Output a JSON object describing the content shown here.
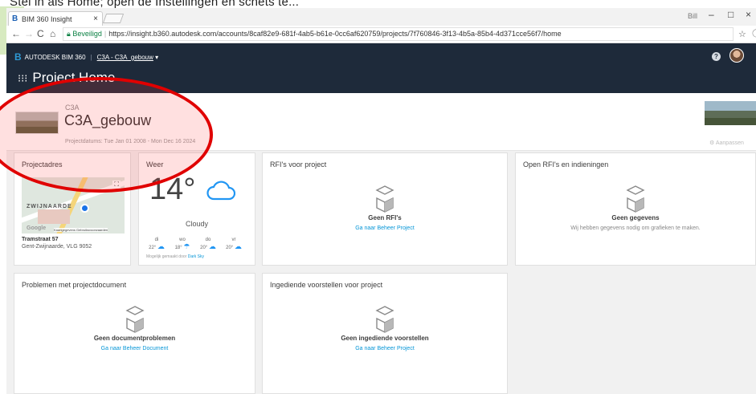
{
  "overlay_text": "Stel in als Home; open de Instellingen en schets te...",
  "browser": {
    "tab_title": "BIM 360 Insight",
    "win_user": "Bill",
    "secure_label": "Beveiligd",
    "url": "https://insight.b360.autodesk.com/accounts/8caf82e9-681f-4ab5-b61e-0cc6af620759/projects/7f760846-3f13-4b5a-85b4-4d371cce56f7/home"
  },
  "header": {
    "brand": "AUTODESK BIM 360",
    "breadcrumb": "C3A - C3A_gebouw",
    "page_title": "Project Home"
  },
  "project": {
    "subtitle": "C3A",
    "name": "C3A_gebouw",
    "dates": "Projectdatums: Tue Jan 01 2008 - Mon Dec 16 2024",
    "customize": "Aanpassen"
  },
  "cards": {
    "address": {
      "title": "Projectadres",
      "map_label": "ZWIJNAARDE",
      "map_brand": "Google",
      "map_data": "Kaartgegevens   Gebruiksvoorwaarden",
      "street": "Tramstraat 57",
      "city": "Gent-Zwijnaarde, VLG 9052"
    },
    "weather": {
      "title": "Weer",
      "temp": "14°",
      "condition": "Cloudy",
      "forecast": [
        {
          "day": "di",
          "temp": "22°"
        },
        {
          "day": "wo",
          "temp": "18°"
        },
        {
          "day": "do",
          "temp": "20°"
        },
        {
          "day": "vr",
          "temp": "20°"
        }
      ],
      "powered": "Mogelijk gemaakt door",
      "powered_by": "Dark Sky"
    },
    "rfis": {
      "title": "RFI's voor project",
      "empty": "Geen RFI's",
      "link": "Ga naar Beheer Project"
    },
    "open_rfis": {
      "title": "Open RFI's en indieningen",
      "empty": "Geen gegevens",
      "note": "Wij hebben gegevens nodig om grafieken te maken."
    },
    "doc_issues": {
      "title": "Problemen met projectdocument",
      "empty": "Geen documentproblemen",
      "link": "Ga naar Beheer Document"
    },
    "submittals": {
      "title": "Ingediende voorstellen voor project",
      "empty": "Geen ingediende voorstellen",
      "link": "Ga naar Beheer Project"
    }
  },
  "colors": {
    "header_bg": "#1e2a3a",
    "link": "#0696d7",
    "annotation": "#e00000"
  }
}
